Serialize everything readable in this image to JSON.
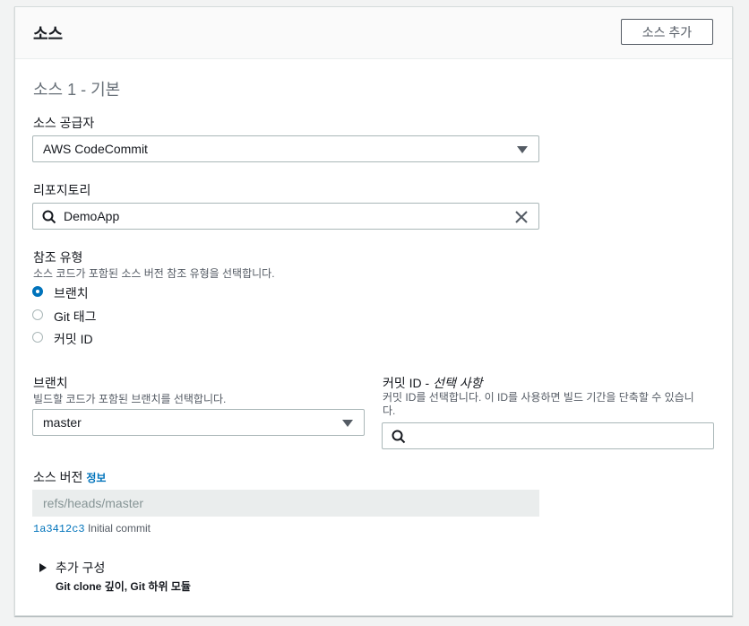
{
  "panel": {
    "title": "소스",
    "add_source_button": "소스 추가"
  },
  "section_heading": "소스 1 - 기본",
  "provider": {
    "label": "소스 공급자",
    "value": "AWS CodeCommit"
  },
  "repository": {
    "label": "리포지토리",
    "value": "DemoApp"
  },
  "reference_type": {
    "label": "참조 유형",
    "description": "소스 코드가 포함된 소스 버전 참조 유형을 선택합니다.",
    "options": [
      {
        "label": "브랜치",
        "selected": true
      },
      {
        "label": "Git 태그",
        "selected": false
      },
      {
        "label": "커밋 ID",
        "selected": false
      }
    ]
  },
  "branch": {
    "label": "브랜치",
    "description": "빌드할 코드가 포함된 브랜치를 선택합니다.",
    "value": "master"
  },
  "commit_id": {
    "label": "커밋 ID - ",
    "optional": "선택 사항",
    "description_line1": "커밋 ID를 선택합니다. 이 ID를 사용하면 빌드 기간을 단축할 수 있습니",
    "description_line2": "다.",
    "value": ""
  },
  "source_version": {
    "label": "소스 버전",
    "info_link": "정보",
    "value": "refs/heads/master",
    "commit_hash": "1a3412c3",
    "commit_message": "Initial commit"
  },
  "additional_config": {
    "label": "추가 구성",
    "summary": "Git clone 깊이, Git 하위 모듈"
  },
  "colors": {
    "accent": "#0073bb",
    "border": "#aab7b8",
    "disabled_bg": "#eaeded"
  }
}
